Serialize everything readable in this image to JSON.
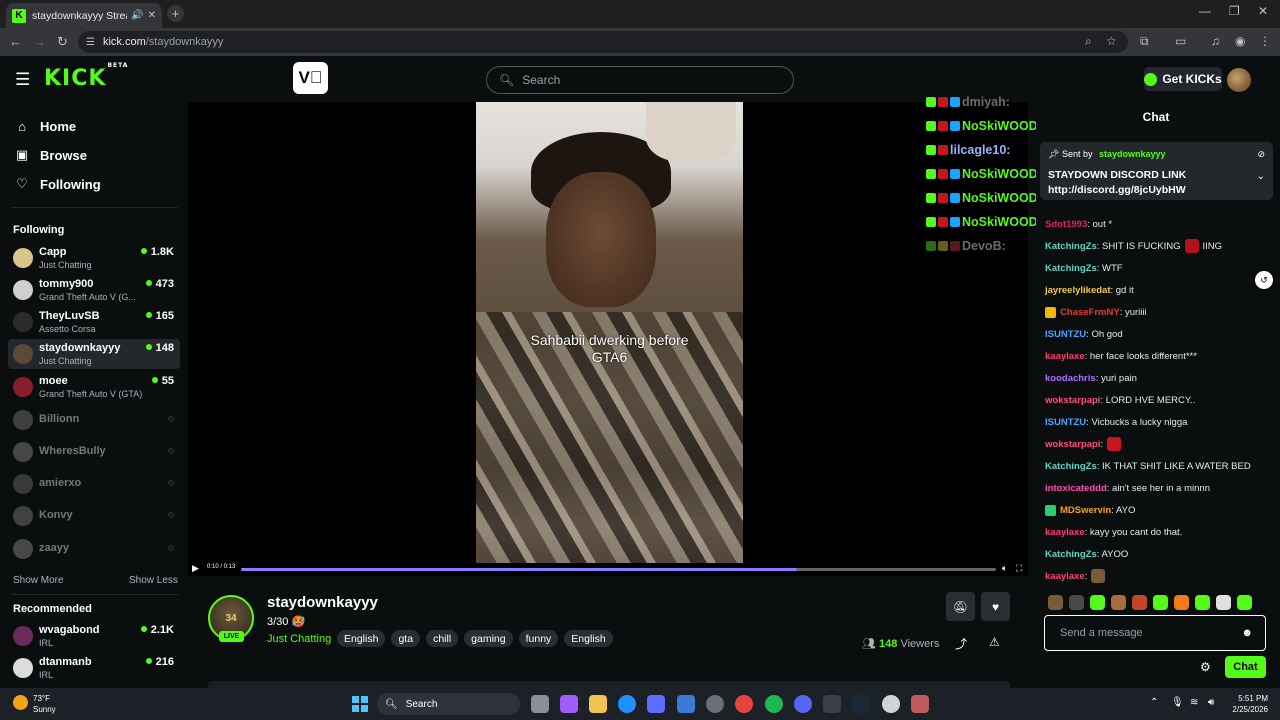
{
  "browser": {
    "tab_title": "staydownkayyy Stream - W",
    "tab_favicon_letter": "K",
    "url_host": "kick.com",
    "url_path": "/staydownkayyy"
  },
  "header": {
    "logo": "KICK",
    "logo_sup": "BETA",
    "search_placeholder": "Search",
    "get_kicks_label": "Get KICKs"
  },
  "sidebar": {
    "nav": [
      {
        "label": "Home",
        "icon": "home-icon"
      },
      {
        "label": "Browse",
        "icon": "browse-icon"
      },
      {
        "label": "Following",
        "icon": "heart-icon"
      }
    ],
    "following_heading": "Following",
    "following": [
      {
        "name": "Capp",
        "category": "Just Chatting",
        "viewers": "1.8K",
        "avatar_color": "#d9c48a"
      },
      {
        "name": "tommy900",
        "category": "Grand Theft Auto V (G...",
        "viewers": "473",
        "avatar_color": "#cfcfcf"
      },
      {
        "name": "TheyLuvSB",
        "category": "Assetto Corsa",
        "viewers": "165",
        "avatar_color": "#2b2b2b"
      },
      {
        "name": "staydownkayyy",
        "category": "Just Chatting",
        "viewers": "148",
        "avatar_color": "#5c4a35"
      },
      {
        "name": "moee",
        "category": "Grand Theft Auto V (GTA)",
        "viewers": "55",
        "avatar_color": "#8a1d2b"
      }
    ],
    "offline": [
      {
        "name": "Billionn",
        "avatar_color": "#8a8a8a"
      },
      {
        "name": "WheresBully",
        "avatar_color": "#9a9a9a"
      },
      {
        "name": "amierxo",
        "avatar_color": "#7a7a7a"
      },
      {
        "name": "Konvy",
        "avatar_color": "#8f8f8f"
      },
      {
        "name": "zaayy",
        "avatar_color": "#a0a0a0"
      }
    ],
    "show_more": "Show More",
    "show_less": "Show Less",
    "recommended_heading": "Recommended",
    "recommended": [
      {
        "name": "wvagabond",
        "category": "IRL",
        "viewers": "2.1K",
        "avatar_color": "#6b2a5c"
      },
      {
        "name": "dtanmanb",
        "category": "IRL",
        "viewers": "216",
        "avatar_color": "#dcdcdc"
      }
    ]
  },
  "video": {
    "caption_line1": "Sahbabii dwerking before",
    "caption_line2": "GTA6",
    "time": "0:10 / 0:13",
    "progress": 0.737,
    "overlay_chat": [
      {
        "name": "dmiyah:",
        "color": "#6b6b6b"
      },
      {
        "name": "NoSkiWOODS:",
        "color": "#53fc18"
      },
      {
        "name": "lilcagle10:",
        "color": "#9fb0ff"
      },
      {
        "name": "NoSkiWOODS:",
        "color": "#53fc18"
      },
      {
        "name": "NoSkiWOODS:",
        "color": "#53fc18"
      },
      {
        "name": "NoSkiWOODS:",
        "color": "#53fc18"
      },
      {
        "name": "DevoB:",
        "color": "#6b6b6b"
      }
    ]
  },
  "channel": {
    "name": "staydownkayyy",
    "title": "3/30 🥵",
    "category": "Just Chatting",
    "live_badge": "LIVE",
    "avatar_text": "34",
    "tags": [
      "English",
      "gta",
      "chill",
      "gaming",
      "funny",
      "English"
    ],
    "viewers_count": "148",
    "viewers_label": "Viewers"
  },
  "chat": {
    "title": "Chat",
    "pinned_sent_by": "Sent by",
    "pinned_user": "staydownkayyy",
    "pinned_line1": "STAYDOWN DISCORD LINK",
    "pinned_line2": "http://discord.gg/8jcUybHW",
    "messages": [
      {
        "user": "Sdot1993",
        "color": "#e91e63",
        "text": ": out *",
        "badge": ""
      },
      {
        "user": "KatchingZs",
        "color": "#5ed6c3",
        "text": ": SHIT IS FUCKING",
        "tail": "IING",
        "badge": "",
        "emote": "#b3121d"
      },
      {
        "user": "KatchingZs",
        "color": "#5ed6c3",
        "text": ": WTF",
        "badge": ""
      },
      {
        "user": "jayreelylikedat",
        "color": "#f2c94c",
        "text": ": gd it",
        "badge": ""
      },
      {
        "user": "ChaseFrmNY",
        "color": "#e53935",
        "text": ": yuriiii",
        "badge": "#f2b705"
      },
      {
        "user": "ISUNTZU",
        "color": "#4aa3ff",
        "text": ": Oh god",
        "badge": ""
      },
      {
        "user": "kaaylaxe",
        "color": "#ff3d6e",
        "text": ": her face looks different***",
        "badge": ""
      },
      {
        "user": "koodachris",
        "color": "#b06cff",
        "text": ": yuri pain",
        "badge": ""
      },
      {
        "user": "wokstarpapi",
        "color": "#ff4d7d",
        "text": ": LORD HVE MERCY..",
        "badge": ""
      },
      {
        "user": "ISUNTZU",
        "color": "#4aa3ff",
        "text": ": Vicbucks a lucky nigga",
        "badge": ""
      },
      {
        "user": "wokstarpapi",
        "color": "#ff4d7d",
        "text": ":",
        "badge": "",
        "emote": "#c4161c"
      },
      {
        "user": "KatchingZs",
        "color": "#5ed6c3",
        "text": ": IK THAT SHIT LIKE A WATER BED",
        "badge": ""
      },
      {
        "user": "intoxicateddd",
        "color": "#ff4fb0",
        "text": ": ain't see her in a minnn",
        "badge": ""
      },
      {
        "user": "MDSwervin",
        "color": "#f7a31a",
        "text": ": AYO",
        "badge": "#2ecc71"
      },
      {
        "user": "kaaylaxe",
        "color": "#ff3d6e",
        "text": ": kayy you cant do that.",
        "badge": ""
      },
      {
        "user": "KatchingZs",
        "color": "#5ed6c3",
        "text": ": AYOO",
        "badge": ""
      },
      {
        "user": "kaaylaxe",
        "color": "#ff3d6e",
        "text": ":",
        "badge": "",
        "emote": "#7a5a3a"
      }
    ],
    "emote_bar": [
      "#7a5a3a",
      "#4a4a4a",
      "#53fc18",
      "#a86b3c",
      "#c2462b",
      "#53fc18",
      "#f27a1a",
      "#53fc18",
      "#e0e0e0",
      "#53fc18"
    ],
    "input_placeholder": "Send a message",
    "send_label": "Chat"
  },
  "taskbar": {
    "temperature": "73°F",
    "condition": "Sunny",
    "search_label": "Search",
    "time": "5:51 PM",
    "date": "2/25/2026"
  }
}
